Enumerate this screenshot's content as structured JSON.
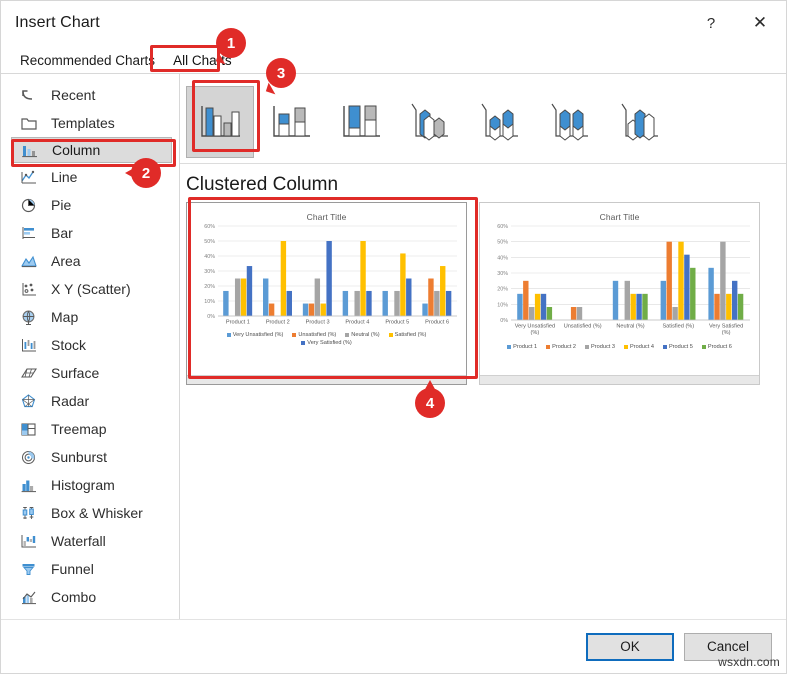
{
  "window": {
    "title": "Insert Chart",
    "help_label": "?",
    "close_label": "✕"
  },
  "tabs": [
    {
      "label": "Recommended Charts",
      "active": false
    },
    {
      "label": "All Charts",
      "active": true
    }
  ],
  "categories": [
    {
      "label": "Recent",
      "icon": "undo-arrow-icon",
      "selected": false
    },
    {
      "label": "Templates",
      "icon": "folder-icon",
      "selected": false
    },
    {
      "label": "Column",
      "icon": "column-chart-icon",
      "selected": true
    },
    {
      "label": "Line",
      "icon": "line-chart-icon",
      "selected": false
    },
    {
      "label": "Pie",
      "icon": "pie-chart-icon",
      "selected": false
    },
    {
      "label": "Bar",
      "icon": "bar-chart-icon",
      "selected": false
    },
    {
      "label": "Area",
      "icon": "area-chart-icon",
      "selected": false
    },
    {
      "label": "X Y (Scatter)",
      "icon": "scatter-chart-icon",
      "selected": false
    },
    {
      "label": "Map",
      "icon": "map-globe-icon",
      "selected": false
    },
    {
      "label": "Stock",
      "icon": "stock-chart-icon",
      "selected": false
    },
    {
      "label": "Surface",
      "icon": "surface-chart-icon",
      "selected": false
    },
    {
      "label": "Radar",
      "icon": "radar-chart-icon",
      "selected": false
    },
    {
      "label": "Treemap",
      "icon": "treemap-icon",
      "selected": false
    },
    {
      "label": "Sunburst",
      "icon": "sunburst-icon",
      "selected": false
    },
    {
      "label": "Histogram",
      "icon": "histogram-icon",
      "selected": false
    },
    {
      "label": "Box & Whisker",
      "icon": "box-whisker-icon",
      "selected": false
    },
    {
      "label": "Waterfall",
      "icon": "waterfall-icon",
      "selected": false
    },
    {
      "label": "Funnel",
      "icon": "funnel-icon",
      "selected": false
    },
    {
      "label": "Combo",
      "icon": "combo-chart-icon",
      "selected": false
    }
  ],
  "subtypes": [
    {
      "name": "clustered-column",
      "selected": true
    },
    {
      "name": "stacked-column",
      "selected": false
    },
    {
      "name": "100-percent-stacked-column",
      "selected": false
    },
    {
      "name": "3d-clustered-column",
      "selected": false
    },
    {
      "name": "3d-stacked-column",
      "selected": false
    },
    {
      "name": "3d-100-percent-stacked-column",
      "selected": false
    },
    {
      "name": "3d-column",
      "selected": false
    }
  ],
  "preview": {
    "heading": "Clustered Column"
  },
  "footer": {
    "ok_label": "OK",
    "cancel_label": "Cancel",
    "watermark": "wsxdn.com"
  },
  "annotations": [
    {
      "number": "1",
      "target": "all-charts-tab"
    },
    {
      "number": "2",
      "target": "column-category"
    },
    {
      "number": "3",
      "target": "clustered-column-subtype"
    },
    {
      "number": "4",
      "target": "clustered-column-preview"
    }
  ],
  "colors": {
    "series_1": "#5B9BD5",
    "series_2": "#ED7D31",
    "series_3": "#A5A5A5",
    "series_4": "#FFC000",
    "series_5": "#4472C4",
    "series_6": "#70AD47",
    "annotation": "#e02b28",
    "accent": "#0f6cbd"
  },
  "chart_data": [
    {
      "id": "preview-chart-1",
      "type": "bar",
      "title": "Chart Title",
      "xlabel": "",
      "ylabel": "",
      "ylim": [
        0,
        60
      ],
      "ytick_labels": [
        "0%",
        "10%",
        "20%",
        "30%",
        "40%",
        "50%",
        "60%"
      ],
      "ytick_values": [
        0,
        10,
        20,
        30,
        40,
        50,
        60
      ],
      "grid": true,
      "legend_position": "bottom",
      "categories": [
        "Product 1",
        "Product 2",
        "Product 3",
        "Product 4",
        "Product 5",
        "Product 6"
      ],
      "series": [
        {
          "name": "Very Unsatisfied (%)",
          "color": "#5B9BD5",
          "values": [
            16.7,
            25,
            8.3,
            16.7,
            16.7,
            8.3
          ]
        },
        {
          "name": "Unsatisfied (%)",
          "color": "#ED7D31",
          "values": [
            0,
            8.3,
            8.3,
            0,
            0,
            25
          ]
        },
        {
          "name": "Neutral (%)",
          "color": "#A5A5A5",
          "values": [
            25,
            0,
            25,
            16.7,
            16.7,
            16.7
          ]
        },
        {
          "name": "Satisfied (%)",
          "color": "#FFC000",
          "values": [
            25,
            50,
            8.3,
            50,
            41.7,
            33.3
          ]
        },
        {
          "name": "Very Satisfied (%)",
          "color": "#4472C4",
          "values": [
            33.3,
            16.7,
            50,
            16.7,
            25,
            16.7
          ]
        }
      ]
    },
    {
      "id": "preview-chart-2",
      "type": "bar",
      "title": "Chart Title",
      "xlabel": "",
      "ylabel": "",
      "ylim": [
        0,
        60
      ],
      "ytick_labels": [
        "0%",
        "10%",
        "20%",
        "30%",
        "40%",
        "50%",
        "60%"
      ],
      "ytick_values": [
        0,
        10,
        20,
        30,
        40,
        50,
        60
      ],
      "grid": true,
      "legend_position": "bottom",
      "categories": [
        "Very Unsatisfied (%)",
        "Unsatisfied (%)",
        "Neutral (%)",
        "Satisfied (%)",
        "Very Satisfied (%)"
      ],
      "series": [
        {
          "name": "Product 1",
          "color": "#5B9BD5",
          "values": [
            16.7,
            0,
            25,
            25,
            33.3
          ]
        },
        {
          "name": "Product 2",
          "color": "#ED7D31",
          "values": [
            25,
            8.3,
            0,
            50,
            16.7
          ]
        },
        {
          "name": "Product 3",
          "color": "#A5A5A5",
          "values": [
            8.3,
            8.3,
            25,
            8.3,
            50
          ]
        },
        {
          "name": "Product 4",
          "color": "#FFC000",
          "values": [
            16.7,
            0,
            16.7,
            50,
            16.7
          ]
        },
        {
          "name": "Product 5",
          "color": "#4472C4",
          "values": [
            16.7,
            0,
            16.7,
            41.7,
            25
          ]
        },
        {
          "name": "Product 6",
          "color": "#70AD47",
          "values": [
            8.3,
            0,
            16.7,
            33.3,
            16.7
          ]
        }
      ]
    }
  ]
}
